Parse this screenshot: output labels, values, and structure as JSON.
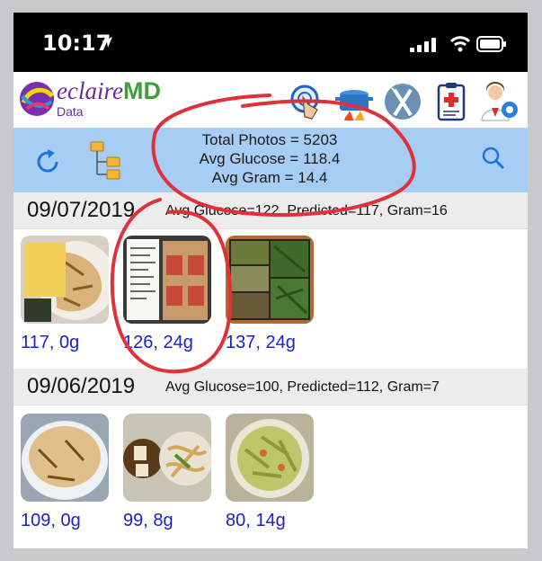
{
  "status": {
    "time": "10:17"
  },
  "header": {
    "brand_main": "eclaire",
    "brand_accent": "MD",
    "brand_sub": "Data"
  },
  "summary": {
    "total_photos": "Total Photos = 5203",
    "avg_glucose": "Avg Glucose = 118.4",
    "avg_gram": "Avg Gram = 14.4"
  },
  "days": [
    {
      "date": "09/07/2019",
      "stats": "Avg Glucose=122, Predicted=117, Gram=16",
      "photos": [
        {
          "caption": "117, 0g"
        },
        {
          "caption": "126, 24g"
        },
        {
          "caption": "137, 24g"
        }
      ]
    },
    {
      "date": "09/06/2019",
      "stats": "Avg Glucose=100, Predicted=112, Gram=7",
      "photos": [
        {
          "caption": "109, 0g"
        },
        {
          "caption": "99, 8g"
        },
        {
          "caption": "80, 14g"
        }
      ]
    }
  ],
  "colors": {
    "summary_bg": "#a8cdf5",
    "caption": "#1c22c4",
    "annotation": "#e0303a",
    "brand_purple": "#6a2a99",
    "brand_green": "#3f9f3a"
  }
}
